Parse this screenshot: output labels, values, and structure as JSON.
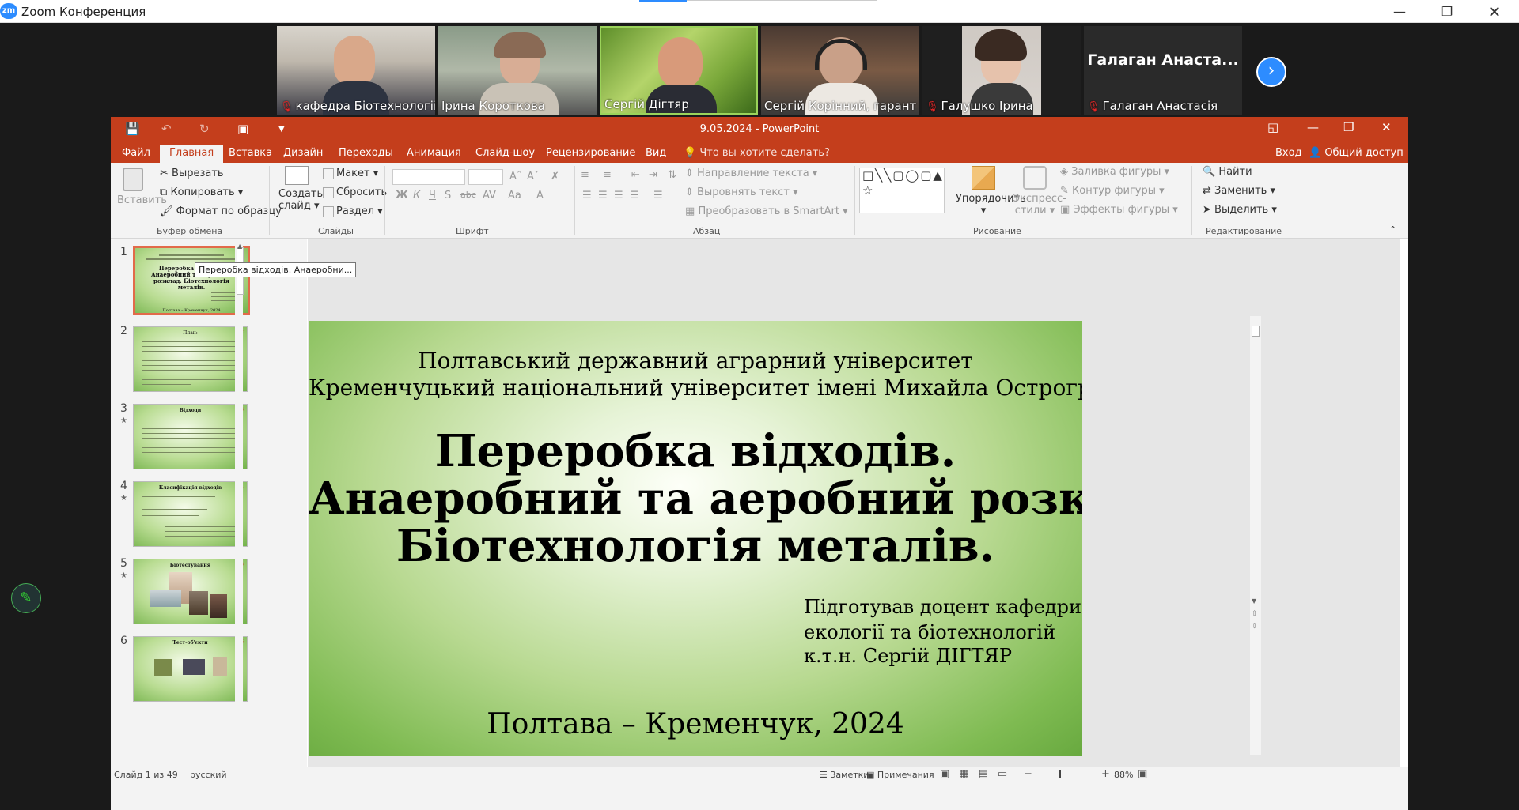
{
  "zoom": {
    "title": "Zoom Конференция",
    "logo": "zm",
    "window_controls": [
      "minimize-icon",
      "restore-icon",
      "close-icon"
    ]
  },
  "participants": [
    {
      "name": "кафедра Біотехнології...",
      "muted": true
    },
    {
      "name": "Ірина Короткова",
      "muted": false
    },
    {
      "name": "Сергій Дігтяр",
      "muted": false
    },
    {
      "name": "Сергій Корінний, гарант",
      "muted": false
    },
    {
      "name": "Галушко Ірина",
      "muted": true
    },
    {
      "name": "Галаган Анастасія",
      "muted": true,
      "avatar_text": "Галаган  Анаста..."
    }
  ],
  "ppt": {
    "title": "9.05.2024 - PowerPoint",
    "tabs": [
      "Файл",
      "Главная",
      "Вставка",
      "Дизайн",
      "Переходы",
      "Анимация",
      "Слайд-шоу",
      "Рецензирование",
      "Вид"
    ],
    "tell_me": "Что вы хотите сделать?",
    "login": "Вход",
    "share": "Общий доступ",
    "ribbon": {
      "paste": "Вставить",
      "cut": "Вырезать",
      "copy": "Копировать",
      "format_painter": "Формат по образцу",
      "clipboard_group": "Буфер обмена",
      "new_slide": "Создать",
      "new_slide2": "слайд",
      "layout": "Макет",
      "reset": "Сбросить",
      "section": "Раздел",
      "slides_group": "Слайды",
      "font_group": "Шрифт",
      "text_direction": "Направление текста",
      "align_text": "Выровнять текст",
      "smartart": "Преобразовать в SmartArt",
      "paragraph_group": "Абзац",
      "arrange": "Упорядочить",
      "quick_styles": "Экспресс-",
      "quick_styles2": "стили",
      "shape_fill": "Заливка фигуры",
      "shape_outline": "Контур фигуры",
      "shape_effects": "Эффекты фигуры",
      "drawing_group": "Рисование",
      "find": "Найти",
      "replace": "Заменить",
      "select": "Выделить",
      "editing_group": "Редактирование"
    },
    "thumbnails": [
      {
        "num": "1",
        "title": "Переробка відходів. Анаеробний та аеробний розклад. Біотехнологія металів.",
        "footer": "Полтава – Кременчук, 2024"
      },
      {
        "num": "2",
        "title": "План:"
      },
      {
        "num": "3",
        "title": "Відходи"
      },
      {
        "num": "4",
        "title": "Класифікація відходів"
      },
      {
        "num": "5",
        "title": "Біотестування"
      },
      {
        "num": "6",
        "title": "Тест-об'єкти"
      }
    ],
    "tooltip": "Переробка відходів. Анаеробни...",
    "slide": {
      "uni1": "Полтавський державний аграрний університет",
      "uni2": "Кременчуцький національний університет імені Михайла Остроградського",
      "title1": "Переробка відходів.",
      "title2": "Анаеробний та аеробний розклад.",
      "title3": "Біотехнологія металів.",
      "author1": "Підготував доцент кафедри",
      "author2": "екології та біотехнологій",
      "author3": "к.т.н. Сергій ДІГТЯР",
      "footer": "Полтава – Кременчук, 2024"
    },
    "status": {
      "slide_info": "Слайд 1 из 49",
      "language": "русский",
      "notes": "Заметки",
      "comments": "Примечания",
      "zoom": "88%"
    }
  }
}
